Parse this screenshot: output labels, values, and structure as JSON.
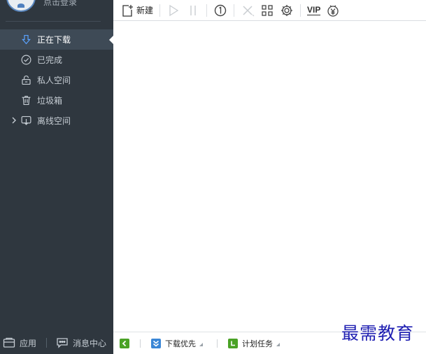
{
  "user": {
    "login_label": "点击登录"
  },
  "sidebar": {
    "items": [
      {
        "label": "正在下载",
        "icon": "download-arrow-icon",
        "active": true
      },
      {
        "label": "已完成",
        "icon": "check-circle-icon",
        "active": false
      },
      {
        "label": "私人空间",
        "icon": "lock-icon",
        "active": false
      },
      {
        "label": "垃圾箱",
        "icon": "trash-icon",
        "active": false
      },
      {
        "label": "离线空间",
        "icon": "cloud-download-icon",
        "active": false
      }
    ],
    "bottom": {
      "apps_label": "应用",
      "messages_label": "消息中心"
    }
  },
  "toolbar": {
    "new_label": "新建",
    "vip_label": "VIP"
  },
  "statusbar": {
    "download_priority_label": "下载优先",
    "scheduled_task_label": "计划任务"
  },
  "watermark": {
    "text": "最需教育"
  },
  "colors": {
    "sidebar_bg": "#2f373f",
    "active_item_bg": "#3e4a56",
    "accent_blue": "#5aa3ff",
    "green": "#4aa226",
    "watermark": "#1f1fb2"
  }
}
